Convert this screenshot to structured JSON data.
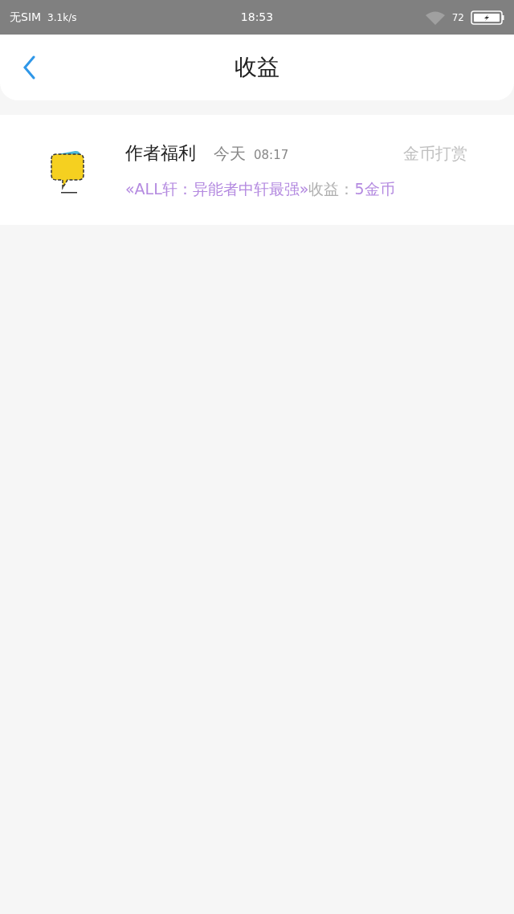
{
  "status_bar": {
    "carrier": "无SIM",
    "speed": "3.1k/s",
    "time": "18:53",
    "battery": "72"
  },
  "header": {
    "title": "收益"
  },
  "records": [
    {
      "sender": "作者福利",
      "date": "今天",
      "time": "08:17",
      "type": "金币打赏",
      "message": [
        {
          "kind": "highlight",
          "text": "«ALL轩：异能者中轩最强»"
        },
        {
          "kind": "plain",
          "text": "收益："
        },
        {
          "kind": "highlight",
          "text": "5金币"
        }
      ]
    }
  ]
}
